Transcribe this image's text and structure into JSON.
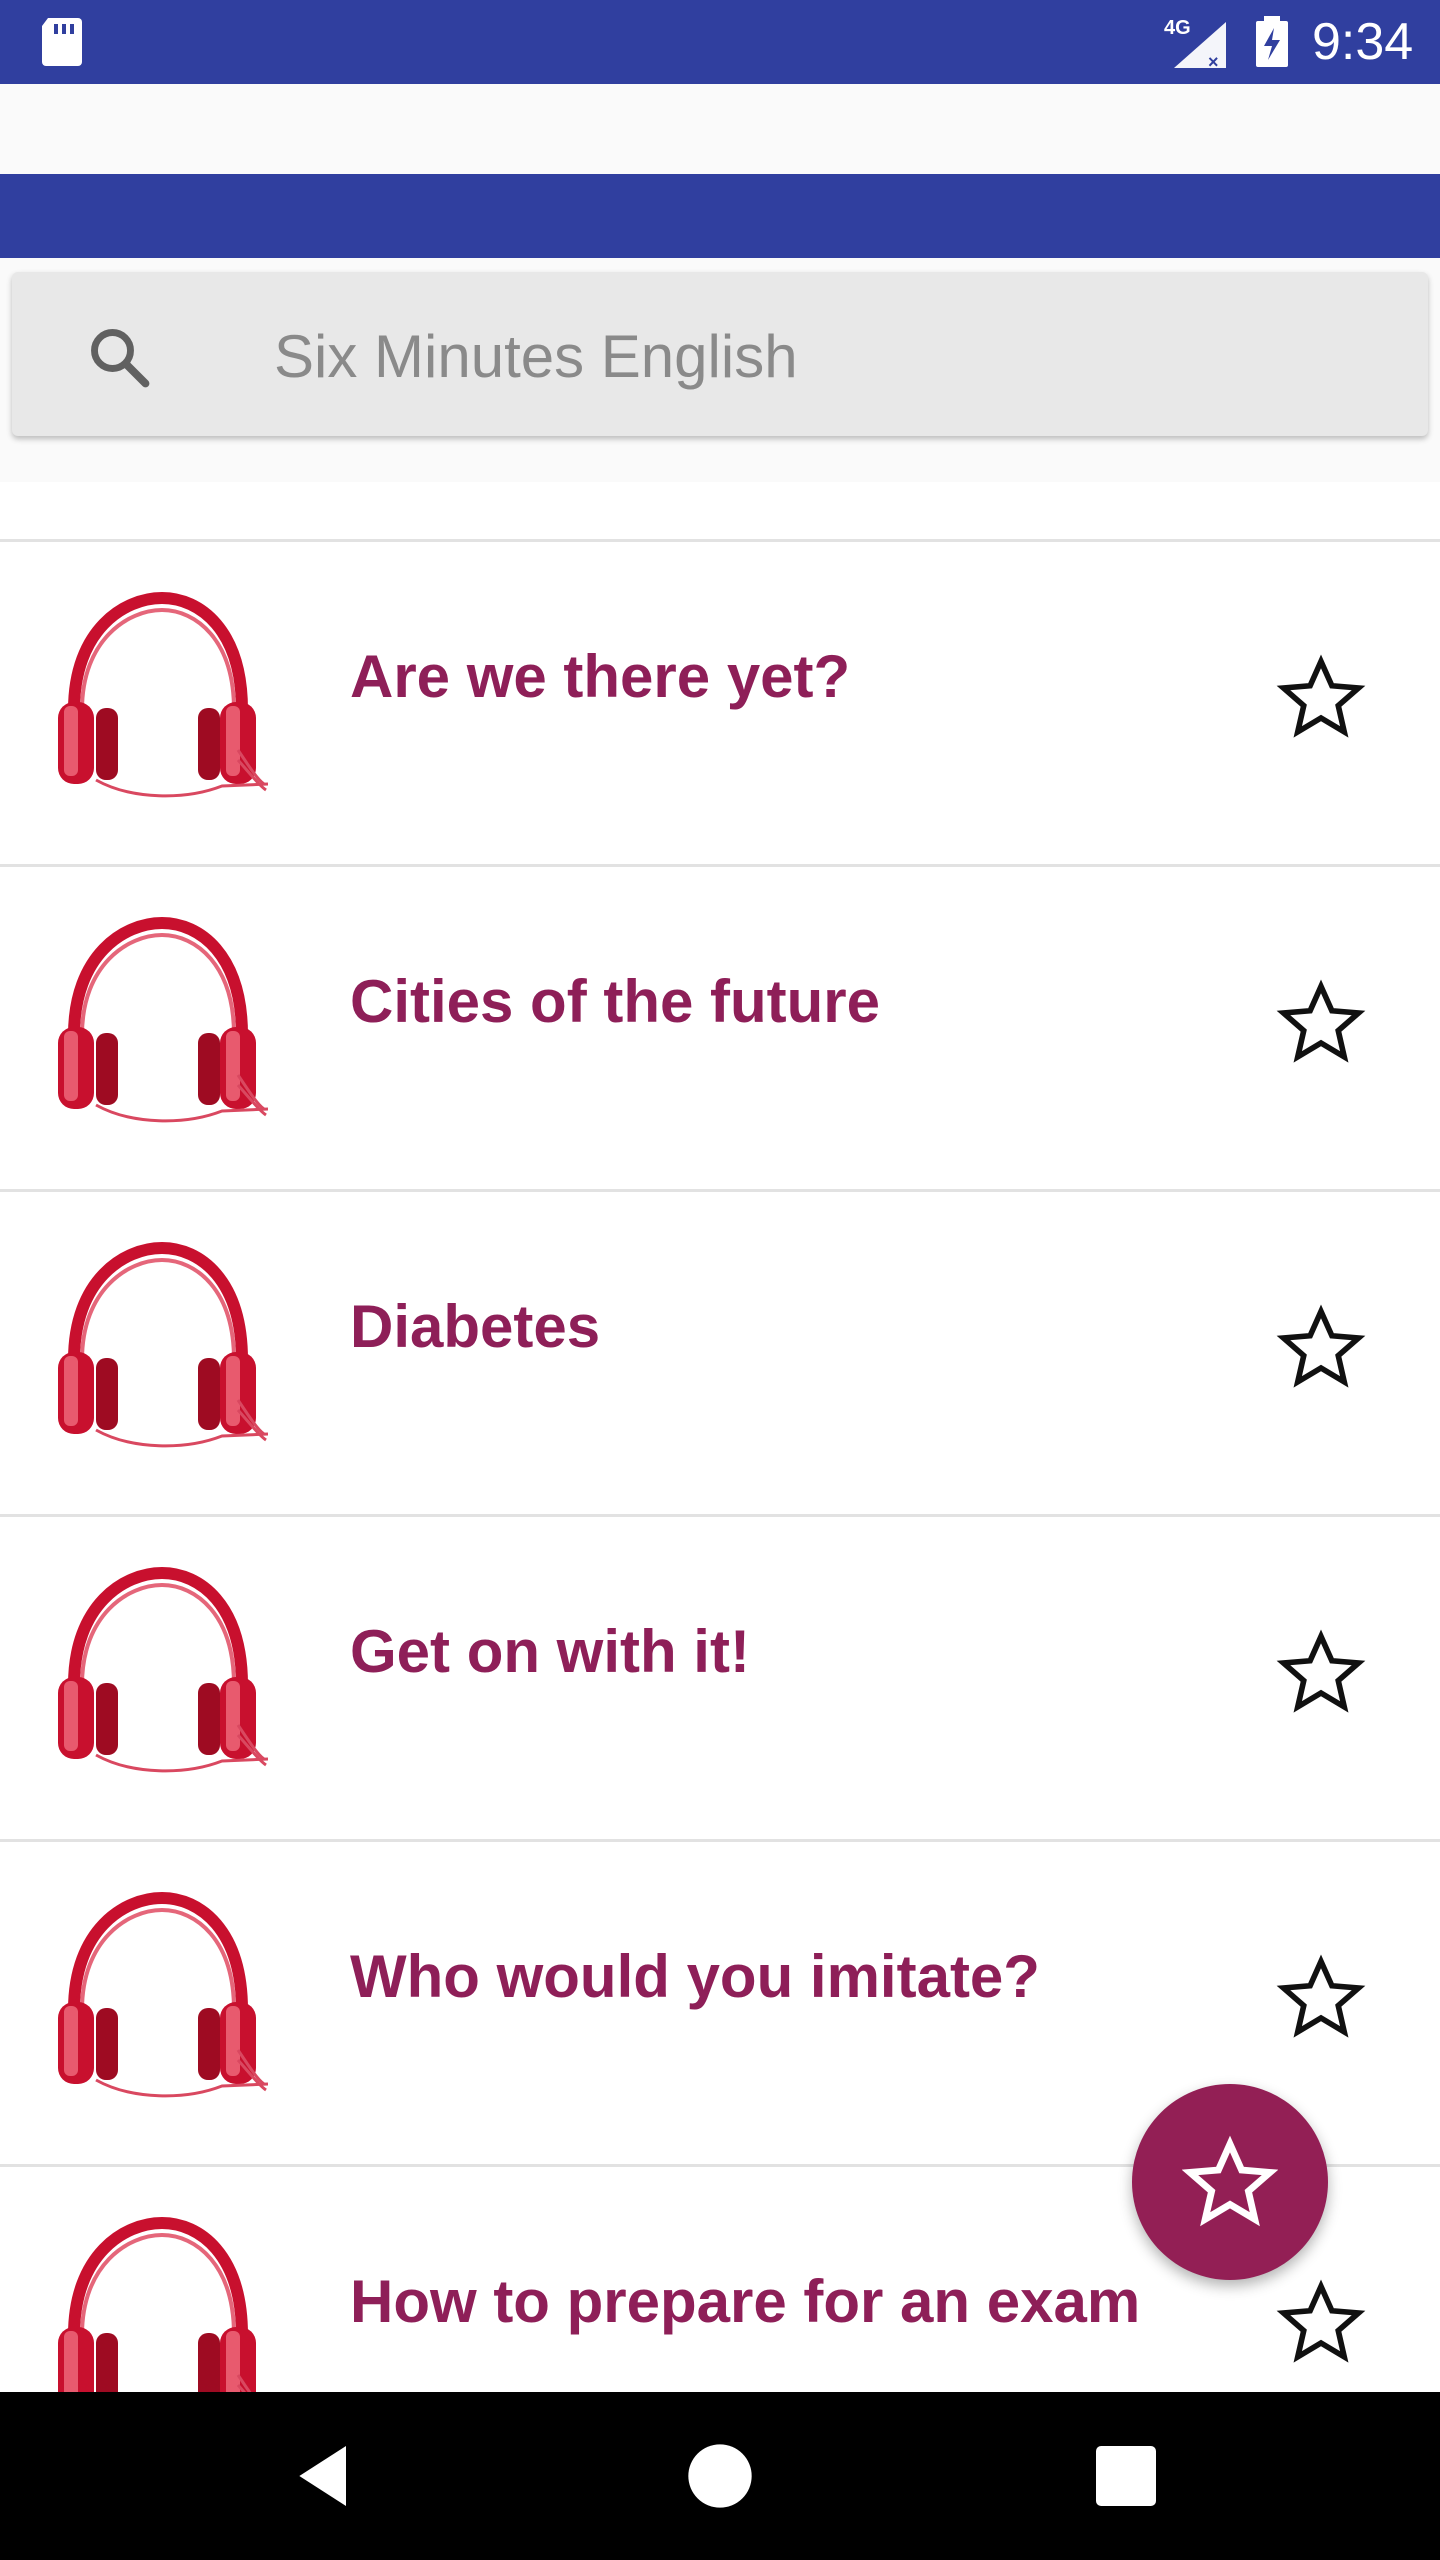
{
  "status_bar": {
    "time": "9:34",
    "network_label": "4G",
    "icons": [
      "sd-card-icon",
      "signal-4g-icon",
      "battery-icon"
    ]
  },
  "search": {
    "placeholder": "Six Minutes English",
    "icon": "search-icon"
  },
  "episodes": [
    {
      "title": ""
    },
    {
      "title": "Are we there yet?"
    },
    {
      "title": "Cities of the future"
    },
    {
      "title": "Diabetes"
    },
    {
      "title": "Get on with it!"
    },
    {
      "title": "Who would you imitate?"
    },
    {
      "title": "How to prepare for an exam"
    }
  ],
  "fab": {
    "icon": "star-icon"
  },
  "nav": {
    "icons": [
      "back-icon",
      "home-icon",
      "recents-icon"
    ]
  },
  "colors": {
    "primary": "#303f9f",
    "accent": "#931f55",
    "title_text": "#8e1f58",
    "headphone_red": "#c8102e"
  }
}
